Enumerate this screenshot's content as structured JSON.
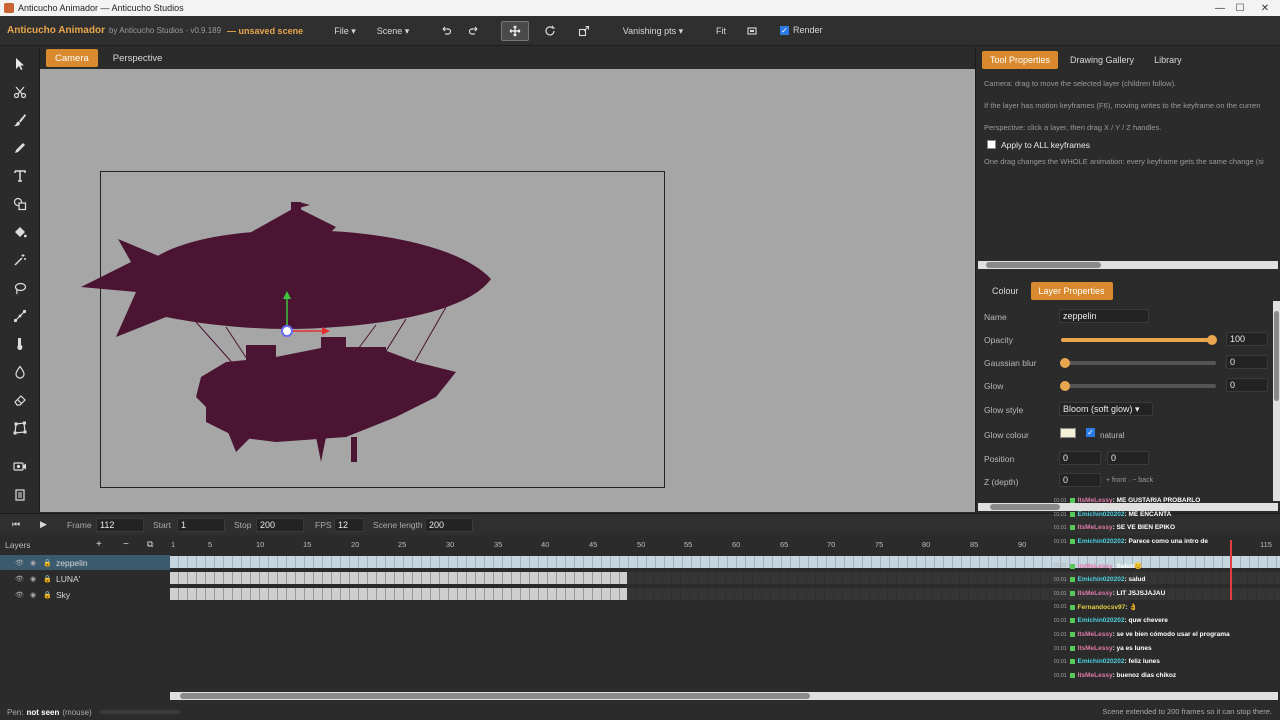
{
  "window": {
    "title": "Anticucho Animador — Anticucho Studios",
    "controls": [
      "—",
      "☐",
      "✕"
    ]
  },
  "menubar": {
    "brand": "Anticucho Animador",
    "subtitle": "by Anticucho Studios · v0.9.189",
    "unsaved": "— unsaved scene",
    "file": "File ▾",
    "scene": "Scene ▾",
    "vanishing": "Vanishing pts ▾",
    "fit": "Fit",
    "render": "Render",
    "render_checked": true
  },
  "canvas_tabs": [
    "Camera",
    "Perspective"
  ],
  "right_panel": {
    "tabs": [
      "Tool Properties",
      "Drawing Gallery",
      "Library"
    ],
    "help": [
      "Camera: drag to move the selected layer (children follow).",
      "If the layer has motion keyframes (F6), moving writes to the keyframe on the curren",
      "Perspective: click a layer, then drag X / Y / Z handles."
    ],
    "apply_all": "Apply to ALL keyframes",
    "apply_note": "One drag changes the WHOLE animation: every keyframe gets the same change (si",
    "sub_tabs": [
      "Colour",
      "Layer Properties"
    ],
    "props": {
      "name_label": "Name",
      "name_value": "zeppelin",
      "opacity_label": "Opacity",
      "opacity_value": "100",
      "blur_label": "Gaussian blur",
      "blur_value": "0",
      "glow_label": "Glow",
      "glow_value": "0",
      "glow_style_label": "Glow style",
      "glow_style_value": "Bloom (soft glow) ▾",
      "glow_colour_label": "Glow colour",
      "natural_label": "natural",
      "position_label": "Position",
      "position_x": "0",
      "position_y": "0",
      "z_label": "Z (depth)",
      "z_value": "0",
      "z_hint": "+ front · − back"
    }
  },
  "playbar": {
    "frame_label": "Frame",
    "frame_value": "112",
    "start_label": "Start",
    "start_value": "1",
    "stop_label": "Stop",
    "stop_value": "200",
    "fps_label": "FPS",
    "fps_value": "12",
    "length_label": "Scene length",
    "length_value": "200"
  },
  "timeline": {
    "layers_label": "Layers",
    "add": "+",
    "remove": "−",
    "ticks": [
      "1",
      "5",
      "10",
      "15",
      "20",
      "25",
      "30",
      "35",
      "40",
      "45",
      "50",
      "55",
      "60",
      "65",
      "70",
      "75",
      "80",
      "85",
      "90",
      "115"
    ],
    "layers": [
      "zeppelin",
      "LUNA'",
      "Sky"
    ]
  },
  "chat": [
    {
      "time": "01:01",
      "user": "ItsMeLessy",
      "msg": ": ME GUSTARIA PROBARLO",
      "color": "#e07aa8"
    },
    {
      "time": "01:01",
      "user": "Emichin020202",
      "msg": ": ME ENCANTA",
      "color": "#4fd0e0"
    },
    {
      "time": "01:01",
      "user": "ItsMeLessy",
      "msg": ": SE VE BIEN EPIKO",
      "color": "#e07aa8"
    },
    {
      "time": "01:01",
      "user": "Emichin020202",
      "msg": ": Parece como una intro de",
      "color": "#4fd0e0"
    },
    {
      "time": "01:01",
      "user": "ItsMeLessy",
      "msg": ": Salud😊",
      "color": "#e07aa8"
    },
    {
      "time": "01:01",
      "user": "Emichin020202",
      "msg": ": salud",
      "color": "#4fd0e0"
    },
    {
      "time": "01:01",
      "user": "ItsMeLessy",
      "msg": ": LIT JSJSJAJAU",
      "color": "#e07aa8"
    },
    {
      "time": "01:01",
      "user": "Fernandocsv97",
      "msg": ": 👌",
      "color": "#e8d040"
    },
    {
      "time": "01:01",
      "user": "Emichin020202",
      "msg": ": quw chevere",
      "color": "#4fd0e0"
    },
    {
      "time": "01:01",
      "user": "ItsMeLessy",
      "msg": ": se ve bien cómodo usar el programa",
      "color": "#e07aa8"
    },
    {
      "time": "01:01",
      "user": "ItsMeLessy",
      "msg": ": ya es lunes",
      "color": "#e07aa8"
    },
    {
      "time": "01:01",
      "user": "Emichin020202",
      "msg": ": feliz lunes",
      "color": "#4fd0e0"
    },
    {
      "time": "01:01",
      "user": "ItsMeLessy",
      "msg": ": buenoz dias chikoz",
      "color": "#e07aa8"
    }
  ],
  "status": {
    "pen_prefix": "Pen:",
    "pen_state": "not seen",
    "pen_source": "(mouse)",
    "right": "Scene extended to 200 frames so it can stop there."
  },
  "colors": {
    "accent": "#d98a2e",
    "ship": "#4a1432",
    "viewport": "#a6a6a6"
  }
}
